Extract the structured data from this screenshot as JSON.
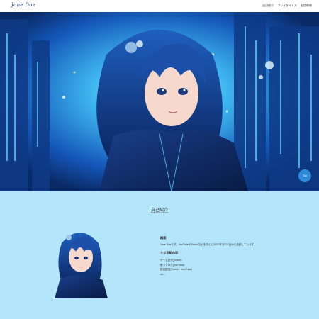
{
  "header": {
    "logo": "Jane Doe",
    "nav": [
      "自己紹介",
      "プレイタイトル",
      "配信情報"
    ]
  },
  "hero": {
    "top_button": "Top",
    "accent_color": "#2b8bd9"
  },
  "intro": {
    "title_ja": "自己紹介",
    "title_en": "Introduction",
    "overview_heading": "概要",
    "overview_text": "Jane Doeです。YouTubeやTwitchなどを中心に2022年7月21日から活動しています。",
    "activities_heading": "主な活動内容",
    "activities": [
      "ゲーム実況(Twitch)",
      "歌ってみた(YouTube)",
      "雑談配信(Twitch・YouTube)",
      "etc..."
    ]
  }
}
